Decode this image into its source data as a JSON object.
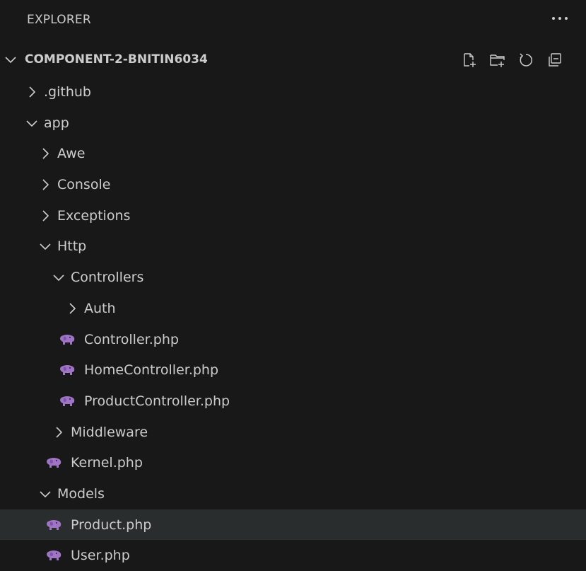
{
  "panel": {
    "title": "EXPLORER",
    "more_icon": "ellipsis-icon"
  },
  "section": {
    "title": "COMPONENT-2-BNITIN6034",
    "expanded": true,
    "actions": [
      {
        "icon": "new-file-icon"
      },
      {
        "icon": "new-folder-icon"
      },
      {
        "icon": "refresh-icon"
      },
      {
        "icon": "collapse-all-icon"
      }
    ]
  },
  "tree": [
    {
      "label": ".github",
      "type": "folder",
      "expanded": false,
      "depth": 0
    },
    {
      "label": "app",
      "type": "folder",
      "expanded": true,
      "depth": 0
    },
    {
      "label": "Awe",
      "type": "folder",
      "expanded": false,
      "depth": 1
    },
    {
      "label": "Console",
      "type": "folder",
      "expanded": false,
      "depth": 1
    },
    {
      "label": "Exceptions",
      "type": "folder",
      "expanded": false,
      "depth": 1
    },
    {
      "label": "Http",
      "type": "folder",
      "expanded": true,
      "depth": 1
    },
    {
      "label": "Controllers",
      "type": "folder",
      "expanded": true,
      "depth": 2
    },
    {
      "label": "Auth",
      "type": "folder",
      "expanded": false,
      "depth": 3
    },
    {
      "label": "Controller.php",
      "type": "file",
      "icon": "php-elephant-icon",
      "depth": 3
    },
    {
      "label": "HomeController.php",
      "type": "file",
      "icon": "php-elephant-icon",
      "depth": 3
    },
    {
      "label": "ProductController.php",
      "type": "file",
      "icon": "php-elephant-icon",
      "depth": 3
    },
    {
      "label": "Middleware",
      "type": "folder",
      "expanded": false,
      "depth": 2
    },
    {
      "label": "Kernel.php",
      "type": "file",
      "icon": "php-elephant-icon",
      "depth": 2
    },
    {
      "label": "Models",
      "type": "folder",
      "expanded": true,
      "depth": 1
    },
    {
      "label": "Product.php",
      "type": "file",
      "icon": "php-elephant-icon",
      "depth": 2,
      "selected": true
    },
    {
      "label": "User.php",
      "type": "file",
      "icon": "php-elephant-icon",
      "depth": 2
    }
  ],
  "colors": {
    "background": "#181818",
    "text": "#cccccc",
    "selected_row": "#2a2d2e",
    "php_icon": "#a074c4"
  }
}
